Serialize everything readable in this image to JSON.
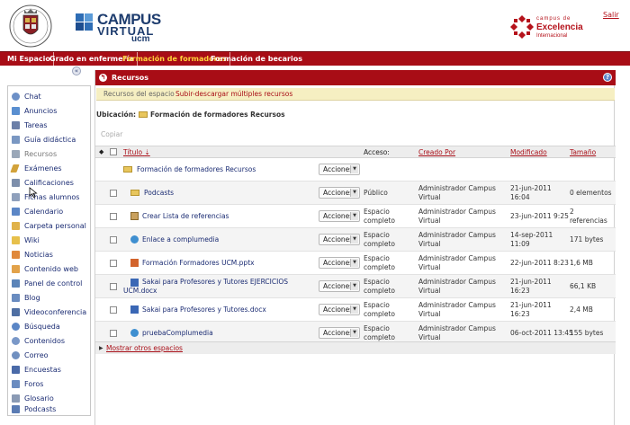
{
  "header": {
    "campus_virtual_line1": "CAMPUS",
    "campus_virtual_line2": "VIRTUAL",
    "campus_virtual_line3": "ucm",
    "excellence_line1": "campus de",
    "excellence_line2": "Excelencia",
    "excellence_line3": "Internacional",
    "logout_label": "Salir",
    "brand_color": "#a80d16",
    "campus_color": "#1d3c6e"
  },
  "nav": {
    "tabs": [
      {
        "label": "Mi Espacio"
      },
      {
        "label": "Grado en enfermería"
      },
      {
        "label": "Formación de formadores",
        "active": true
      },
      {
        "label": "Formación de becarios"
      }
    ]
  },
  "sidebar": {
    "collapse_glyph": "«",
    "items": [
      {
        "label": "Chat",
        "icon": "chat-icon",
        "color": "#6d90c7"
      },
      {
        "label": "Anuncios",
        "icon": "megaphone-icon",
        "color": "#5a8fd0"
      },
      {
        "label": "Tareas",
        "icon": "tasks-icon",
        "color": "#6b7fa8"
      },
      {
        "label": "Guía didáctica",
        "icon": "book-icon",
        "color": "#7a97c2"
      },
      {
        "label": "Recursos",
        "icon": "folder-icon",
        "color": "#9aa7b8",
        "current": true
      },
      {
        "label": "Exámenes",
        "icon": "pencil-icon",
        "color": "#d2a23a"
      },
      {
        "label": "Calificaciones",
        "icon": "gradebook-icon",
        "color": "#7d8fab"
      },
      {
        "label": "Fichas alumnos",
        "icon": "id-card-icon",
        "color": "#8fa0bc"
      },
      {
        "label": "Calendario",
        "icon": "calendar-icon",
        "color": "#5b86c6"
      },
      {
        "label": "Carpeta personal",
        "icon": "folder-icon",
        "color": "#e0b24a"
      },
      {
        "label": "Wiki",
        "icon": "wiki-icon",
        "color": "#e7c04b"
      },
      {
        "label": "Noticias",
        "icon": "rss-icon",
        "color": "#e0893c"
      },
      {
        "label": "Contenido web",
        "icon": "web-content-icon",
        "color": "#e2a24a"
      },
      {
        "label": "Panel de control",
        "icon": "control-panel-icon",
        "color": "#5b84b8"
      },
      {
        "label": "Blog",
        "icon": "blog-icon",
        "color": "#6a8cc0"
      },
      {
        "label": "Videoconferencia",
        "icon": "video-icon",
        "color": "#4f6fa3"
      },
      {
        "label": "Búsqueda",
        "icon": "search-icon",
        "color": "#5b86c6"
      },
      {
        "label": "Contenidos",
        "icon": "contents-icon",
        "color": "#7a98c8"
      },
      {
        "label": "Correo",
        "icon": "mail-icon",
        "color": "#7090c0"
      },
      {
        "label": "Encuestas",
        "icon": "survey-icon",
        "color": "#4a6aa8"
      },
      {
        "label": "Foros",
        "icon": "forum-icon",
        "color": "#6a8cc0"
      },
      {
        "label": "Glosario",
        "icon": "glossary-icon",
        "color": "#8a9ab4"
      },
      {
        "label": "Podcasts",
        "icon": "podcast-icon",
        "color": "#5a7bb3"
      }
    ]
  },
  "tool": {
    "title": "Recursos",
    "help_glyph": "?",
    "subnav": [
      {
        "label": "Recursos del espacio",
        "selected": true
      },
      {
        "label": "Subir-descargar múltiples recursos"
      }
    ],
    "location_label": "Ubicación:",
    "location_value": "Formación de formadores Recursos",
    "copy_label": "Copiar",
    "columns": {
      "title": "Título",
      "access": "Acceso:",
      "created_by": "Creado Por",
      "modified": "Modificado",
      "size": "Tamaño"
    },
    "root_folder": {
      "name": "Formación de formadores Recursos",
      "actions": "Acciones"
    },
    "rows": [
      {
        "name": "Podcasts",
        "kind": "folder",
        "actions": "Acciones",
        "access": "Público",
        "created_by_1": "Administrador Campus",
        "created_by_2": "Virtual",
        "modified_1": "21-jun-2011",
        "modified_2": "16:04",
        "size_1": "0 elementos",
        "size_2": ""
      },
      {
        "name": "Crear Lista de referencias",
        "kind": "citation-list",
        "actions": "Acciones",
        "access_1": "Espacio",
        "access_2": "completo",
        "created_by_1": "Administrador Campus",
        "created_by_2": "Virtual",
        "modified_1": "23-jun-2011 9:25",
        "modified_2": "",
        "size_1": "2",
        "size_2": "referencias"
      },
      {
        "name": "Enlace a complumedia",
        "kind": "link",
        "actions": "Acciones",
        "access_1": "Espacio",
        "access_2": "completo",
        "created_by_1": "Administrador Campus",
        "created_by_2": "Virtual",
        "modified_1": "14-sep-2011",
        "modified_2": "11:09",
        "size_1": "171 bytes",
        "size_2": ""
      },
      {
        "name": "Formación Formadores UCM.pptx",
        "kind": "pptx",
        "actions": "Acciones",
        "access_1": "Espacio",
        "access_2": "completo",
        "created_by_1": "Administrador Campus",
        "created_by_2": "Virtual",
        "modified_1": "22-jun-2011 8:23",
        "modified_2": "",
        "size_1": "1,6 MB",
        "size_2": ""
      },
      {
        "name_1": "Sakai para Profesores y Tutores EJERCICIOS",
        "name_2": "UCM.docx",
        "kind": "docx",
        "actions": "Acciones",
        "access_1": "Espacio",
        "access_2": "completo",
        "created_by_1": "Administrador Campus",
        "created_by_2": "Virtual",
        "modified_1": "21-jun-2011",
        "modified_2": "16:23",
        "size_1": "66,1 KB",
        "size_2": ""
      },
      {
        "name": "Sakai para Profesores y Tutores.docx",
        "kind": "docx",
        "actions": "Acciones",
        "access_1": "Espacio",
        "access_2": "completo",
        "created_by_1": "Administrador Campus",
        "created_by_2": "Virtual",
        "modified_1": "21-jun-2011",
        "modified_2": "16:23",
        "size_1": "2,4 MB",
        "size_2": ""
      },
      {
        "name": "pruebaComplumedia",
        "kind": "link",
        "actions": "Acciones",
        "access_1": "Espacio",
        "access_2": "completo",
        "created_by_1": "Administrador Campus",
        "created_by_2": "Virtual",
        "modified_1": "06-oct-2011 13:45",
        "modified_2": "",
        "size_1": "155 bytes",
        "size_2": ""
      }
    ],
    "show_more_label": "Mostrar otros espacios"
  }
}
